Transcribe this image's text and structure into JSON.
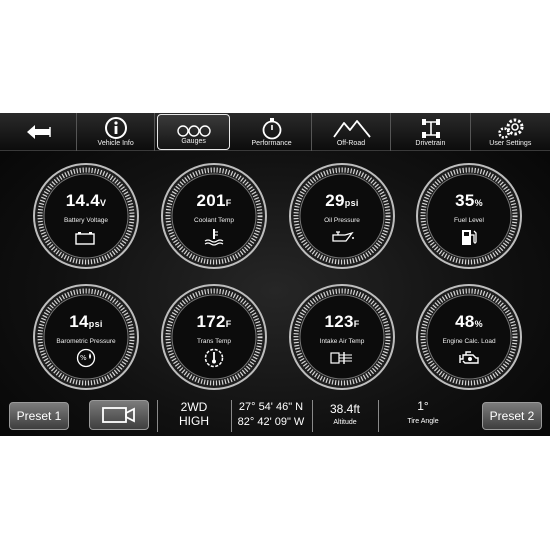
{
  "nav": {
    "back_icon": "back-arrow-icon",
    "items": [
      {
        "label": "Vehicle Info",
        "icon": "info-icon"
      },
      {
        "label": "Gauges",
        "icon": "gauges-icon",
        "active": true
      },
      {
        "label": "Performance",
        "icon": "stopwatch-icon"
      },
      {
        "label": "Off-Road",
        "icon": "mountain-icon"
      },
      {
        "label": "Drivetrain",
        "icon": "drivetrain-icon"
      },
      {
        "label": "User Settings",
        "icon": "gears-icon"
      }
    ]
  },
  "gauges": [
    {
      "value": "14.4",
      "unit": "V",
      "label": "Battery Voltage",
      "icon": "battery-icon"
    },
    {
      "value": "201",
      "unit": "F",
      "label": "Coolant Temp",
      "icon": "coolant-icon"
    },
    {
      "value": "29",
      "unit": "psi",
      "label": "Oil Pressure",
      "icon": "oil-can-icon"
    },
    {
      "value": "35",
      "unit": "%",
      "label": "Fuel Level",
      "icon": "fuel-pump-icon"
    },
    {
      "value": "14",
      "unit": "psi",
      "label": "Barometric Pressure",
      "icon": "barometer-icon"
    },
    {
      "value": "172",
      "unit": "F",
      "label": "Trans Temp",
      "icon": "trans-temp-icon"
    },
    {
      "value": "123",
      "unit": "F",
      "label": "Intake Air Temp",
      "icon": "intake-air-icon"
    },
    {
      "value": "48",
      "unit": "%",
      "label": "Engine Calc. Load",
      "icon": "engine-icon"
    }
  ],
  "bottom": {
    "preset1": "Preset 1",
    "preset2": "Preset 2",
    "camera_icon": "camera-icon",
    "drive_mode_line1": "2WD",
    "drive_mode_line2": "HIGH",
    "lat": "27° 54' 46\" N",
    "lon": "82° 42' 09\" W",
    "altitude_value": "38.4ft",
    "altitude_label": "Altitude",
    "tire_angle_value": "1°",
    "tire_angle_label": "Tire Angle"
  },
  "colors": {
    "background": "#0a0a0a",
    "ring": "#d9d9d9",
    "text": "#ffffff"
  }
}
